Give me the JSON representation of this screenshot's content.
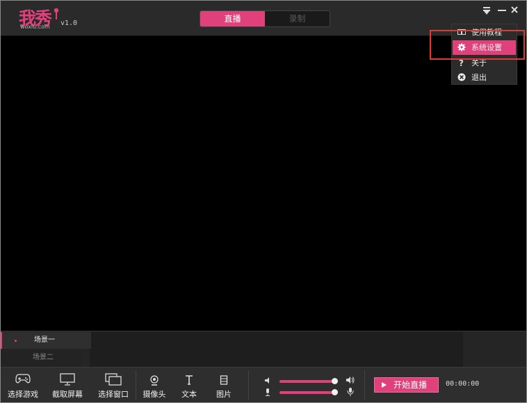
{
  "app": {
    "logo_text": "我秀",
    "logo_sub": "woxiu.com",
    "version": "v1.0"
  },
  "mode_tabs": [
    {
      "label": "直播",
      "active": true
    },
    {
      "label": "录制",
      "active": false
    }
  ],
  "menu": {
    "items": [
      {
        "label": "使用教程",
        "icon": "book-icon"
      },
      {
        "label": "系统设置",
        "icon": "gear-icon",
        "highlighted": true
      },
      {
        "label": "关于",
        "icon": "question-icon"
      },
      {
        "label": "退出",
        "icon": "close-circle-icon"
      }
    ]
  },
  "scenes": [
    {
      "label": "场景一",
      "active": true
    },
    {
      "label": "场景二",
      "active": false
    }
  ],
  "toolbar": {
    "tools": [
      {
        "label": "选择游戏",
        "icon": "gamepad-icon"
      },
      {
        "label": "截取屏幕",
        "icon": "monitor-icon"
      },
      {
        "label": "选择窗口",
        "icon": "window-icon"
      },
      {
        "label": "摄像头",
        "icon": "webcam-icon"
      },
      {
        "label": "文本",
        "icon": "text-icon"
      },
      {
        "label": "图片",
        "icon": "image-icon"
      }
    ],
    "speaker_level": 1.0,
    "mic_level": 1.0,
    "start_label": "开始直播",
    "timer": "00:00:00"
  },
  "colors": {
    "accent": "#e0417a",
    "highlight_box": "#e53935"
  }
}
